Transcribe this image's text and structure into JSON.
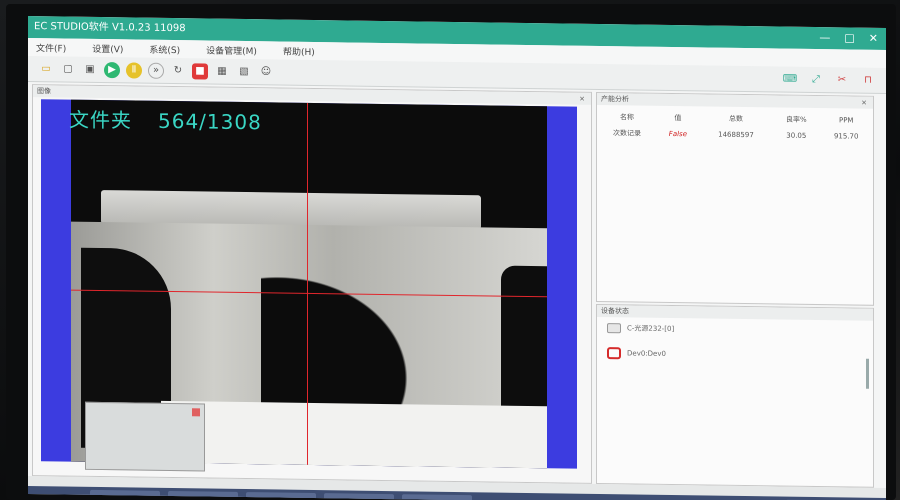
{
  "window": {
    "title": "EC STUDIO软件 V1.0.23 11098"
  },
  "menu": [
    "文件(F)",
    "设置(V)",
    "系统(S)",
    "设备管理(M)",
    "帮助(H)"
  ],
  "image_panel": {
    "header": "图像",
    "overlay_folder": "文件夹",
    "overlay_count": "564/1308"
  },
  "stats_panel": {
    "header": "产能分析",
    "columns": [
      "名称",
      "值",
      "总数",
      "良率%",
      "PPM"
    ],
    "rows": [
      {
        "name": "次数记录",
        "value": "False",
        "total": "14688597",
        "yield": "30.05",
        "ppm": "915.70"
      }
    ]
  },
  "device_panel": {
    "header": "设备状态",
    "items": [
      {
        "label": "C-光源232-[0]",
        "icon": "light-source-icon"
      },
      {
        "label": "Dev0:Dev0",
        "icon": "camera-icon"
      }
    ]
  },
  "colors": {
    "titlebar": "#2faa91",
    "overlay_text": "#3ad6c4",
    "camera_border": "#3c3ce0",
    "crosshair": "#e0262c",
    "error_text": "#d02020"
  }
}
